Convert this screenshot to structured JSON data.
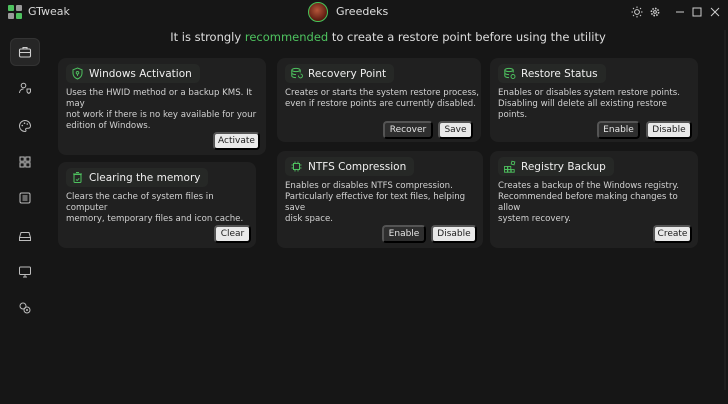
{
  "app": {
    "name": "GTweak",
    "user": "Greedeks"
  },
  "colors": {
    "accent": "#4ec25f",
    "card": "#202020",
    "background": "#161616"
  },
  "titlebar_icons": [
    "theme-toggle-icon",
    "settings-gear-icon",
    "minimize-icon",
    "maximize-icon",
    "close-icon"
  ],
  "sidebar": {
    "items": [
      {
        "icon": "briefcase-icon",
        "active": true
      },
      {
        "icon": "user-shield-icon",
        "active": false
      },
      {
        "icon": "palette-icon",
        "active": false
      },
      {
        "icon": "apps-grid-icon",
        "active": false
      },
      {
        "icon": "services-icon",
        "active": false
      },
      {
        "icon": "drive-icon",
        "active": false
      },
      {
        "icon": "monitor-icon",
        "active": false
      },
      {
        "icon": "system-info-icon",
        "active": false
      }
    ]
  },
  "banner": {
    "before": "It is strongly ",
    "accent": "recommended",
    "after": " to create a restore point before using the utility"
  },
  "cards": {
    "activation": {
      "title": "Windows Activation",
      "icon": "shield-key-icon",
      "desc": [
        "Uses the HWID method or a backup KMS. It may",
        "not work if there is no key available for your",
        "edition of Windows."
      ],
      "buttons": [
        "Activate"
      ]
    },
    "recovery": {
      "title": "Recovery Point",
      "icon": "database-restore-icon",
      "desc": [
        "Creates or starts the system restore process,",
        "even if restore points are currently disabled."
      ],
      "buttons": [
        "Recover",
        "Save"
      ]
    },
    "restore_status": {
      "title": "Restore Status",
      "icon": "database-toggle-icon",
      "desc": [
        "Enables or disables system restore points.",
        "Disabling will delete all existing restore points."
      ],
      "buttons": [
        "Enable",
        "Disable"
      ]
    },
    "clearing": {
      "title": "Clearing the memory",
      "icon": "trash-icon",
      "desc": [
        "Clears the cache of system files in computer",
        "memory, temporary files and icon cache."
      ],
      "buttons": [
        "Clear"
      ]
    },
    "ntfs": {
      "title": "NTFS Compression",
      "icon": "chip-icon",
      "desc": [
        "Enables or disables NTFS compression.",
        "Particularly effective for text files, helping save",
        "disk space."
      ],
      "buttons": [
        "Enable",
        "Disable"
      ]
    },
    "registry": {
      "title": "Registry Backup",
      "icon": "registry-blocks-icon",
      "desc": [
        "Creates a backup of the Windows registry.",
        "Recommended before making changes to allow",
        "system recovery."
      ],
      "buttons": [
        "Create"
      ]
    }
  }
}
